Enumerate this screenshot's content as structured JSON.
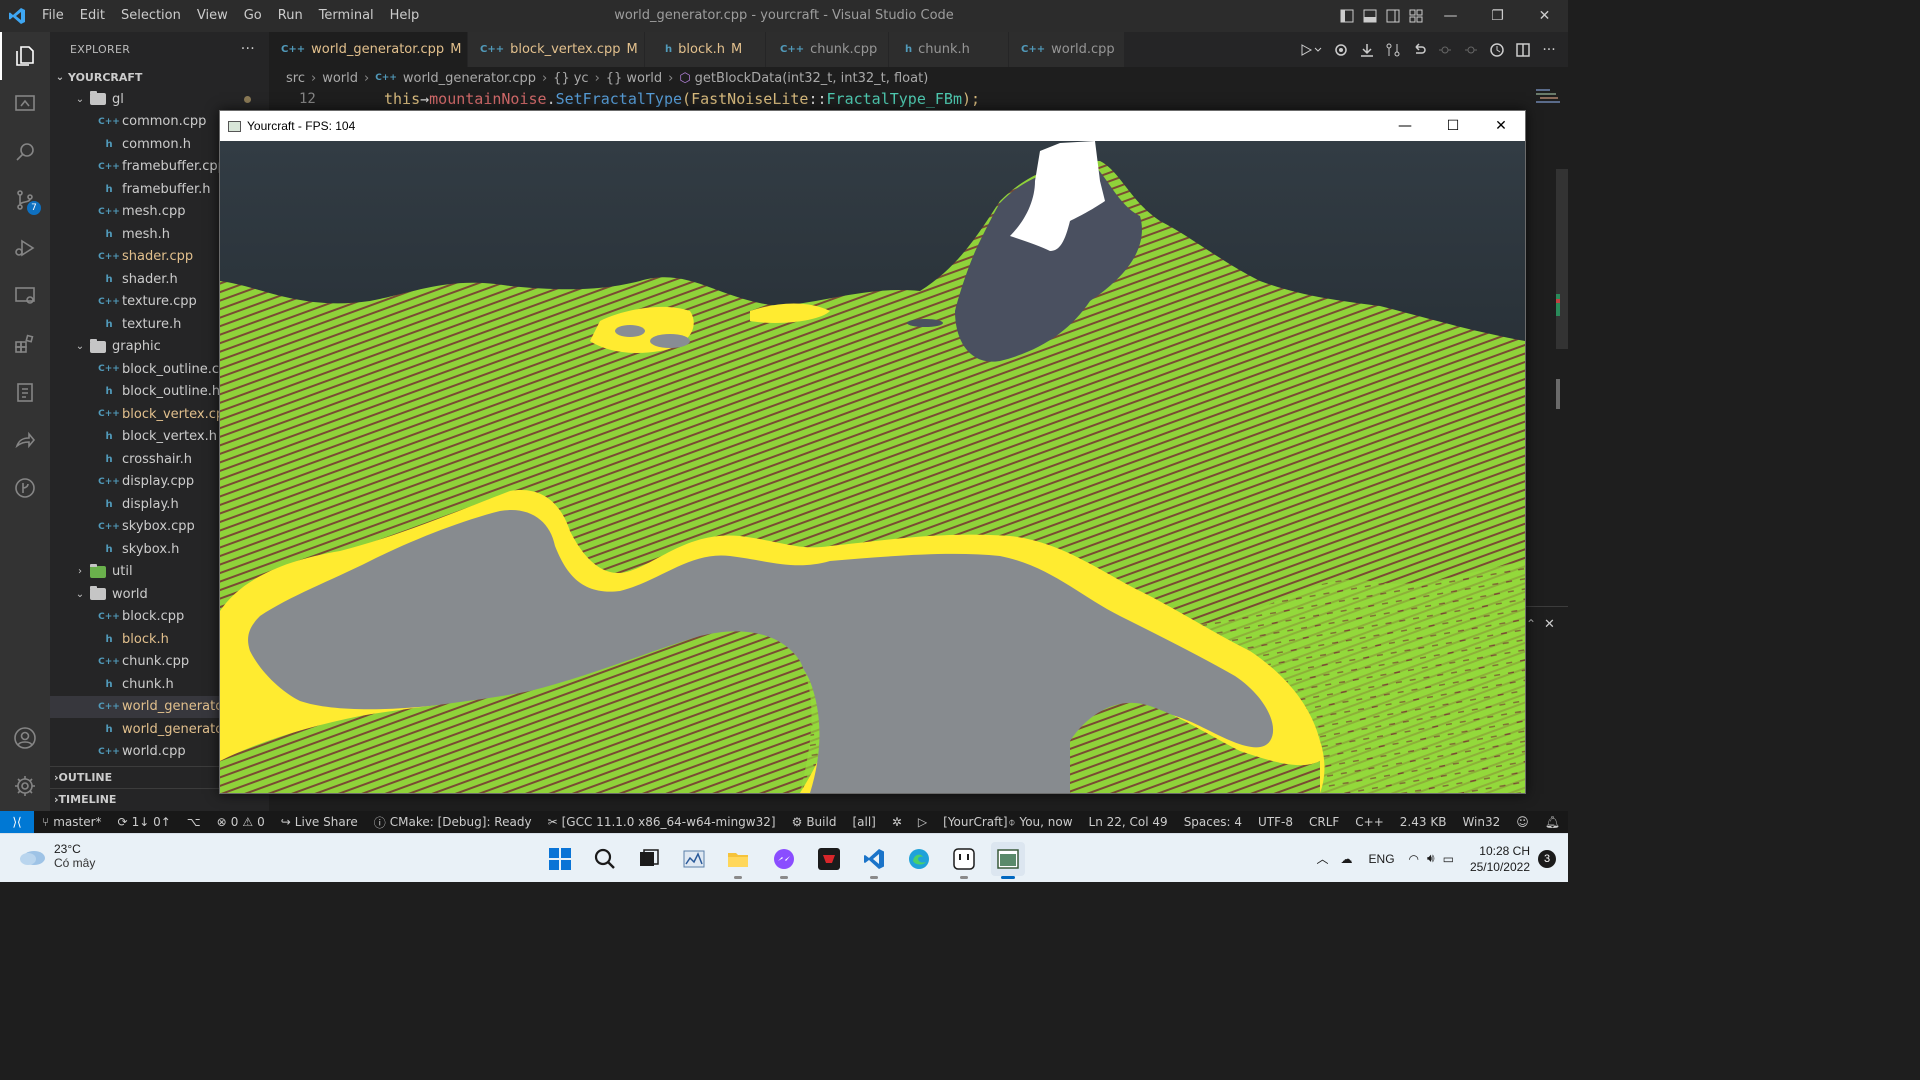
{
  "titlebar": {
    "menu": [
      "File",
      "Edit",
      "Selection",
      "View",
      "Go",
      "Run",
      "Terminal",
      "Help"
    ],
    "window_title": "world_generator.cpp - yourcraft - Visual Studio Code"
  },
  "activitybar": {
    "source_control_badge": "7"
  },
  "sidebar": {
    "header": "EXPLORER",
    "project": "YOURCRAFT",
    "rows": [
      {
        "label": "gl",
        "kind": "folder"
      },
      {
        "label": "common.cpp",
        "kind": "cpp"
      },
      {
        "label": "common.h",
        "kind": "h"
      },
      {
        "label": "framebuffer.cpp",
        "kind": "cpp"
      },
      {
        "label": "framebuffer.h",
        "kind": "h"
      },
      {
        "label": "mesh.cpp",
        "kind": "cpp"
      },
      {
        "label": "mesh.h",
        "kind": "h"
      },
      {
        "label": "shader.cpp",
        "kind": "cpp"
      },
      {
        "label": "shader.h",
        "kind": "h"
      },
      {
        "label": "texture.cpp",
        "kind": "cpp"
      },
      {
        "label": "texture.h",
        "kind": "h"
      },
      {
        "label": "graphic",
        "kind": "folder"
      },
      {
        "label": "block_outline.cpp",
        "kind": "cpp"
      },
      {
        "label": "block_outline.h",
        "kind": "h"
      },
      {
        "label": "block_vertex.cpp",
        "kind": "cpp"
      },
      {
        "label": "block_vertex.h",
        "kind": "h"
      },
      {
        "label": "crosshair.h",
        "kind": "h"
      },
      {
        "label": "display.cpp",
        "kind": "cpp"
      },
      {
        "label": "display.h",
        "kind": "h"
      },
      {
        "label": "skybox.cpp",
        "kind": "cpp"
      },
      {
        "label": "skybox.h",
        "kind": "h"
      },
      {
        "label": "util",
        "kind": "folder"
      },
      {
        "label": "world",
        "kind": "folder"
      },
      {
        "label": "block.cpp",
        "kind": "cpp"
      },
      {
        "label": "block.h",
        "kind": "h"
      },
      {
        "label": "chunk.cpp",
        "kind": "cpp"
      },
      {
        "label": "chunk.h",
        "kind": "h"
      },
      {
        "label": "world_generator.cpp",
        "kind": "cpp"
      },
      {
        "label": "world_generator.h",
        "kind": "h"
      },
      {
        "label": "world.cpp",
        "kind": "cpp"
      }
    ],
    "outline": "OUTLINE",
    "timeline": "TIMELINE"
  },
  "tabs": [
    {
      "label": "world_generator.cpp",
      "icon": "C++",
      "mod": "M"
    },
    {
      "label": "block_vertex.cpp",
      "icon": "C++",
      "mod": "M"
    },
    {
      "label": "block.h",
      "icon": "h",
      "mod": "M"
    },
    {
      "label": "chunk.cpp",
      "icon": "C++",
      "mod": ""
    },
    {
      "label": "chunk.h",
      "icon": "h",
      "mod": ""
    },
    {
      "label": "world.cpp",
      "icon": "C++",
      "mod": ""
    }
  ],
  "breadcrumb": {
    "p1": "src",
    "p2": "world",
    "p3": "world_generator.cpp",
    "p4": "yc",
    "p5": "world",
    "p6": "getBlockData(int32_t, int32_t, float)"
  },
  "code": {
    "line_number": "12",
    "this": "this",
    "arrow": "→",
    "member": "mountainNoise",
    "dot": ".",
    "func": "SetFractalType",
    "lparen": "(",
    "cls": "FastNoiseLite",
    "scope": "::",
    "enum": "FractalType_FBm",
    "end": ");"
  },
  "game_window": {
    "title": "Yourcraft - FPS: 104",
    "min": "—",
    "max": "☐",
    "close": "✕"
  },
  "statusbar": {
    "branch": "master*",
    "sync": "1↓ 0↑",
    "problems": "0",
    "warnings": "0",
    "live_share": "Live Share",
    "cmake": "CMake: [Debug]: Ready",
    "kit": "[GCC 11.1.0 x86_64-w64-mingw32]",
    "build": "Build",
    "target": "[all]",
    "launch": "[YourCraft]",
    "blame": "You, now",
    "position": "Ln 22, Col 49",
    "spaces": "Spaces: 4",
    "encoding": "UTF-8",
    "eol": "CRLF",
    "language": "C++",
    "size": "2.43 KB",
    "platform": "Win32"
  },
  "taskbar": {
    "temperature": "23°C",
    "condition": "Có mây",
    "lang": "ENG",
    "time": "10:28 CH",
    "date": "25/10/2022",
    "notifications": "3"
  }
}
